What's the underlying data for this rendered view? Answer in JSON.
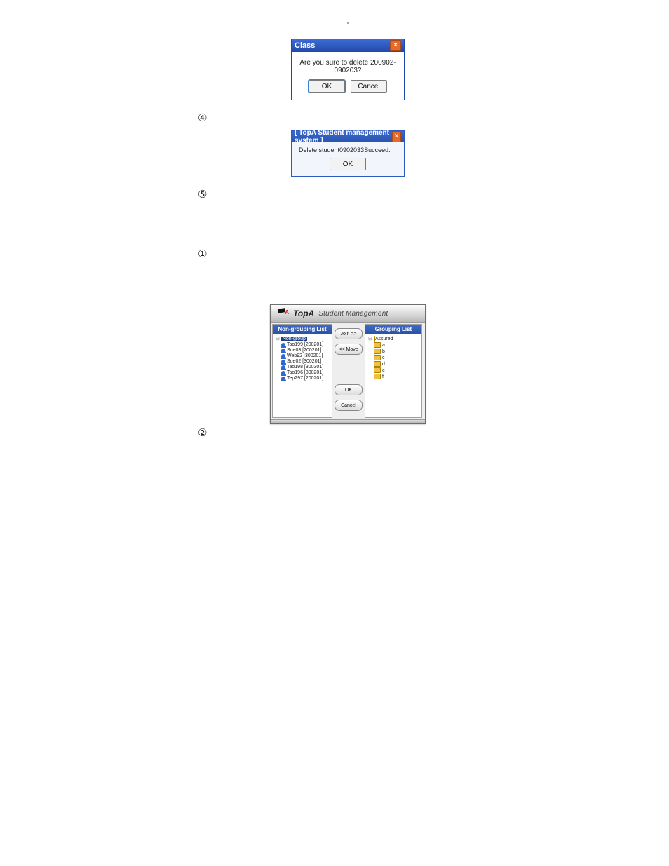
{
  "dialog_class": {
    "title": "Class",
    "message": "Are you sure to delete 200902-090203?",
    "ok": "OK",
    "cancel": "Cancel"
  },
  "dialog_success": {
    "title": "[  TopA Student management system  ]",
    "message": "Delete student0902033Succeed.",
    "ok": "OK"
  },
  "steps": {
    "s4_mark": "④",
    "s5_mark": "⑤",
    "s1_mark": "①",
    "s2_mark": "②"
  },
  "mgmt": {
    "brand_top": "TopA",
    "brand_sub": "Student Management",
    "left_head": "Non-grouping List",
    "right_head": "Grouping List",
    "join": "Join >>",
    "move": "<< Move",
    "ok": "OK",
    "cancel": "Cancel",
    "non_root": "Non-group",
    "students": [
      "Tao199 [200201]",
      "Sue03 [200201]",
      "Web92 [300201]",
      "Sue02 [300201]",
      "Tao198 [300301]",
      "Tao196 [300201]",
      "Tep297 [200201]"
    ],
    "group_root": "Assured",
    "groups": [
      "a",
      "b",
      "c",
      "d",
      "e",
      "f"
    ]
  }
}
